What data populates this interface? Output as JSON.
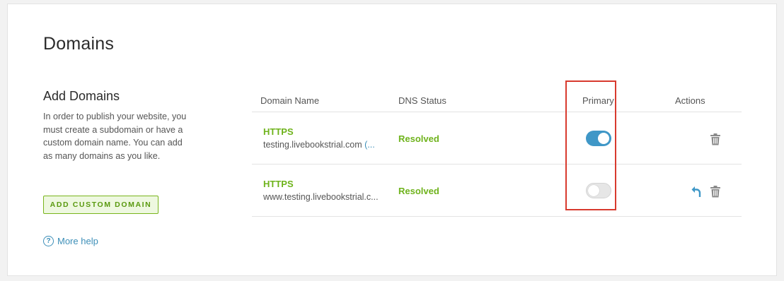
{
  "page": {
    "title": "Domains"
  },
  "add_section": {
    "title": "Add Domains",
    "description": "In order to publish your website, you must create a subdomain or have a custom domain name. You can add as many domains as you like.",
    "button_label": "ADD CUSTOM DOMAIN",
    "help_icon_glyph": "?",
    "help_label": "More help"
  },
  "table": {
    "headers": {
      "domain": "Domain Name",
      "dns": "DNS Status",
      "primary": "Primary",
      "actions": "Actions"
    },
    "rows": [
      {
        "protocol": "HTTPS",
        "domain": "testing.livebookstrial.com",
        "suffix": "(...",
        "dns_status": "Resolved",
        "primary": true,
        "actions": [
          "trash-icon"
        ]
      },
      {
        "protocol": "HTTPS",
        "domain": "www.testing.livebookstrial.c...",
        "suffix": "",
        "dns_status": "Resolved",
        "primary": false,
        "actions": [
          "undo-icon",
          "trash-icon"
        ]
      }
    ]
  },
  "colors": {
    "accent_green": "#6fb31c",
    "accent_blue": "#3f97c7",
    "highlight_red": "#d83a2e"
  }
}
